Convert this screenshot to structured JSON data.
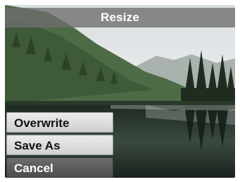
{
  "dialog": {
    "title": "Resize"
  },
  "menu": {
    "items": [
      {
        "label": "Overwrite",
        "selected": false
      },
      {
        "label": "Save As",
        "selected": false
      },
      {
        "label": "Cancel",
        "selected": true
      }
    ]
  },
  "background": {
    "description": "forest-lake-photo"
  },
  "colors": {
    "title_bar": "#6e6e6e",
    "menu_item": "#e0e0e0",
    "menu_item_selected": "#555555"
  }
}
